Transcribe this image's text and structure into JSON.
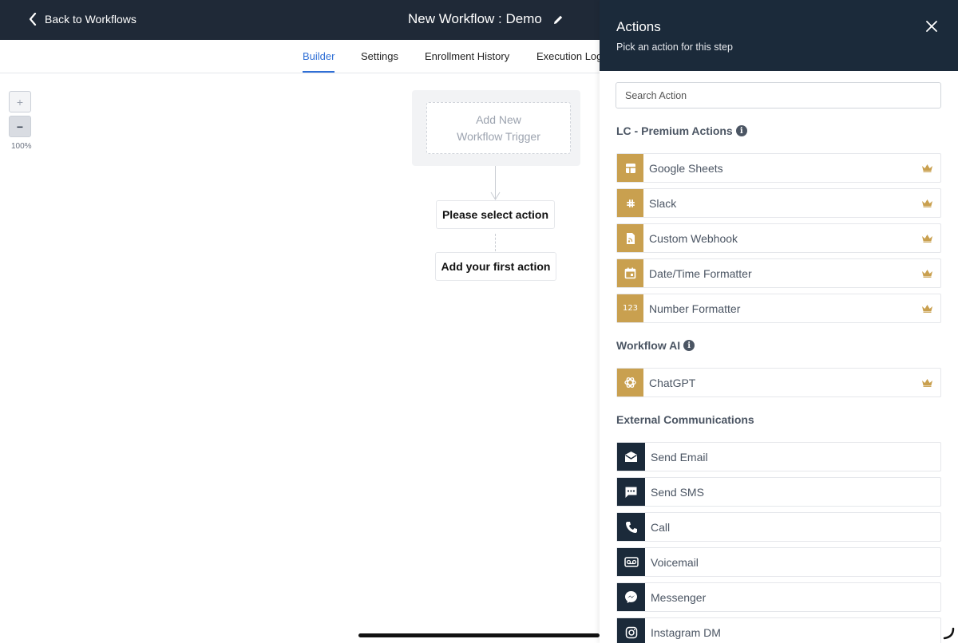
{
  "header": {
    "back_label": "Back to Workflows",
    "title": "New Workflow : Demo"
  },
  "tabs": [
    {
      "label": "Builder",
      "active": true
    },
    {
      "label": "Settings"
    },
    {
      "label": "Enrollment History"
    },
    {
      "label": "Execution Log"
    }
  ],
  "canvas": {
    "zoom_in": "+",
    "zoom_out": "−",
    "zoom_level": "100%",
    "trigger_line1": "Add New",
    "trigger_line2": "Workflow Trigger",
    "node_select": "Please select action",
    "node_first": "Add your first action"
  },
  "panel": {
    "title": "Actions",
    "subtitle": "Pick an action for this step",
    "search_placeholder": "Search Action",
    "sections": {
      "premium": "LC - Premium Actions",
      "ai": "Workflow AI",
      "external": "External Communications"
    },
    "premium_actions": [
      {
        "label": "Google Sheets",
        "icon": "google-sheets-icon"
      },
      {
        "label": "Slack",
        "icon": "slack-icon"
      },
      {
        "label": "Custom Webhook",
        "icon": "webhook-icon"
      },
      {
        "label": "Date/Time Formatter",
        "icon": "calendar-icon"
      },
      {
        "label": "Number Formatter",
        "icon": "number-icon"
      }
    ],
    "ai_actions": [
      {
        "label": "ChatGPT",
        "icon": "chatgpt-icon"
      }
    ],
    "external_actions": [
      {
        "label": "Send Email",
        "icon": "email-icon"
      },
      {
        "label": "Send SMS",
        "icon": "sms-icon"
      },
      {
        "label": "Call",
        "icon": "phone-icon"
      },
      {
        "label": "Voicemail",
        "icon": "voicemail-icon"
      },
      {
        "label": "Messenger",
        "icon": "messenger-icon"
      },
      {
        "label": "Instagram DM",
        "icon": "instagram-icon"
      }
    ]
  },
  "colors": {
    "topbar": "#1f2937",
    "panel_header": "#1b2a3a",
    "premium_gold": "#c9a04f",
    "active_tab": "#2f6fd6"
  }
}
